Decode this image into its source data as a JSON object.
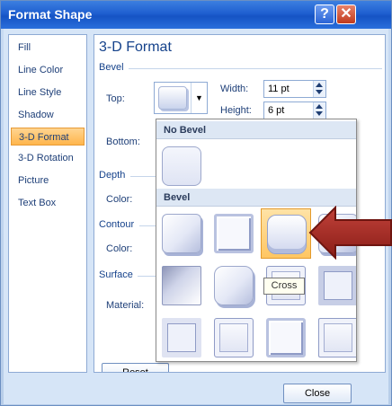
{
  "window": {
    "title": "Format Shape",
    "help_glyph": "?",
    "close_glyph": "✕"
  },
  "nav": {
    "items": [
      {
        "label": "Fill"
      },
      {
        "label": "Line Color"
      },
      {
        "label": "Line Style"
      },
      {
        "label": "Shadow"
      },
      {
        "label": "3-D Format"
      },
      {
        "label": "3-D Rotation"
      },
      {
        "label": "Picture"
      },
      {
        "label": "Text Box"
      }
    ],
    "active": "3-D Format"
  },
  "panel": {
    "title": "3-D Format",
    "bevel_section": "Bevel",
    "top_label": "Top:",
    "bottom_label": "Bottom:",
    "width_label": "Width:",
    "width_value": "11 pt",
    "height_label": "Height:",
    "height_value": "6 pt",
    "depth_section": "Depth",
    "depth_color_label": "Color:",
    "contour_section": "Contour",
    "contour_color_label": "Color:",
    "surface_section": "Surface",
    "material_label": "Material:",
    "reset_label": "Reset"
  },
  "gallery": {
    "no_bevel_header": "No Bevel",
    "bevel_header": "Bevel",
    "selected_index": 2,
    "tooltip": "Cross",
    "tiles": [
      "circle",
      "relaxed-inset",
      "cross",
      "cool-slant",
      "angle",
      "soft-round",
      "convex",
      "slope",
      "divot",
      "riblet",
      "hard-edge",
      "art-deco"
    ]
  },
  "footer": {
    "close_label": "Close"
  },
  "colors": {
    "accent_arrow": "#a3261f",
    "selected_tile": "#ffc662",
    "title_bar": "#1f5fd0"
  }
}
